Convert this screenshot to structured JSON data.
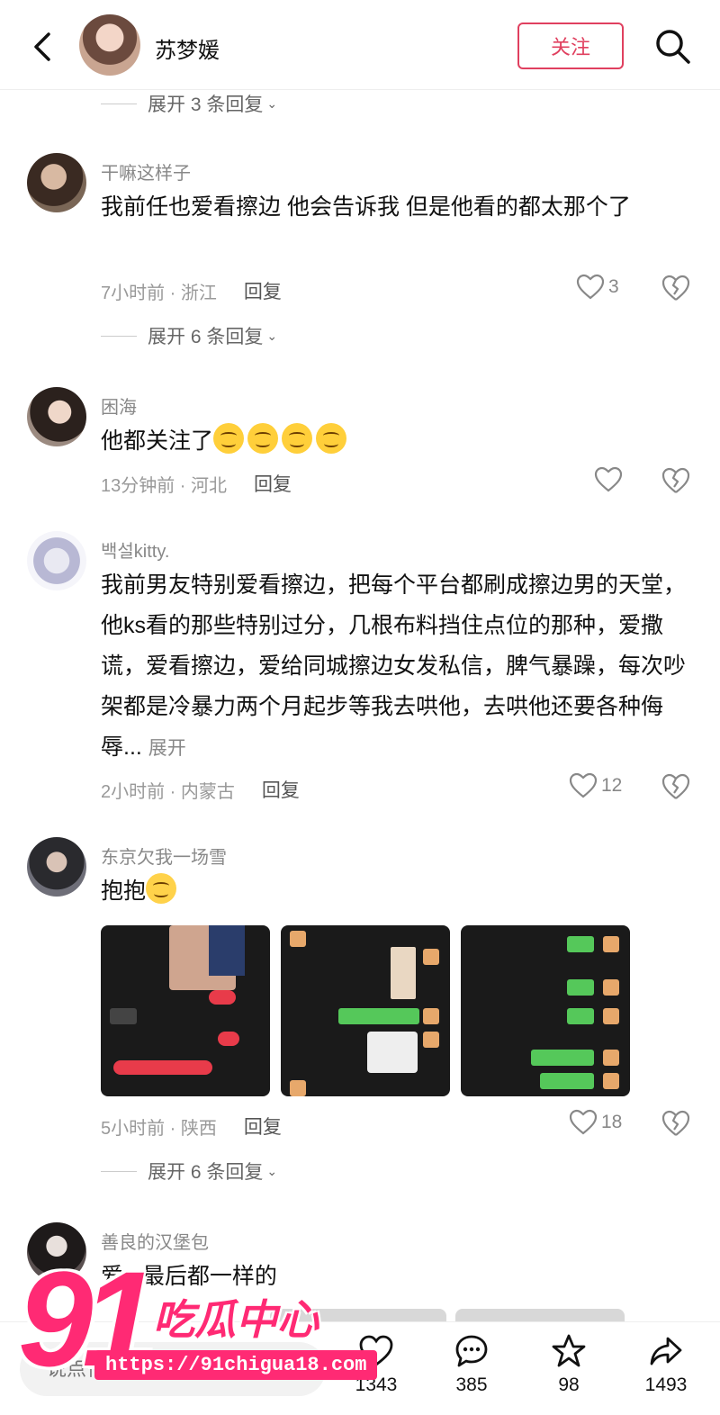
{
  "header": {
    "author_name": "苏梦媛",
    "follow_label": "关注"
  },
  "top_expand": {
    "label": "展开 3 条回复"
  },
  "comments": [
    {
      "username": "干嘛这样子",
      "text": "我前任也爱看擦边 他会告诉我 但是他看的都太那个了",
      "time_location": "7小时前 · 浙江",
      "reply_label": "回复",
      "likes": "3",
      "expand_label": "展开 6 条回复"
    },
    {
      "username": "困海",
      "text": "他都关注了",
      "time_location": "13分钟前 · 河北",
      "reply_label": "回复",
      "likes": ""
    },
    {
      "username": "백설kitty.",
      "text": "我前男友特别爱看擦边，把每个平台都刷成擦边男的天堂，他ks看的那些特别过分，几根布料挡住点位的那种，爱撒谎，爱看擦边，爱给同城擦边女发私信，脾气暴躁，每次吵架都是冷暴力两个月起步等我去哄他，去哄他还要各种侮辱...",
      "more_label": "展开",
      "time_location": "2小时前 · 内蒙古",
      "reply_label": "回复",
      "likes": "12"
    },
    {
      "username": "东京欠我一场雪",
      "text": "抱抱",
      "time_location": "5小时前 · 陕西",
      "reply_label": "回复",
      "likes": "18",
      "expand_label": "展开 6 条回复"
    },
    {
      "username": "善良的汉堡包",
      "text": "爱...最后都一样的"
    }
  ],
  "bottom_bar": {
    "input_placeholder": "说点什么...",
    "like_count": "1343",
    "comment_count": "385",
    "star_count": "98",
    "share_count": "1493"
  },
  "watermark": {
    "number": "91",
    "name": "吃瓜中心",
    "url": "https://91chigua18.com"
  },
  "colors": {
    "accent": "#e0405f",
    "watermark": "#ff2a74"
  }
}
